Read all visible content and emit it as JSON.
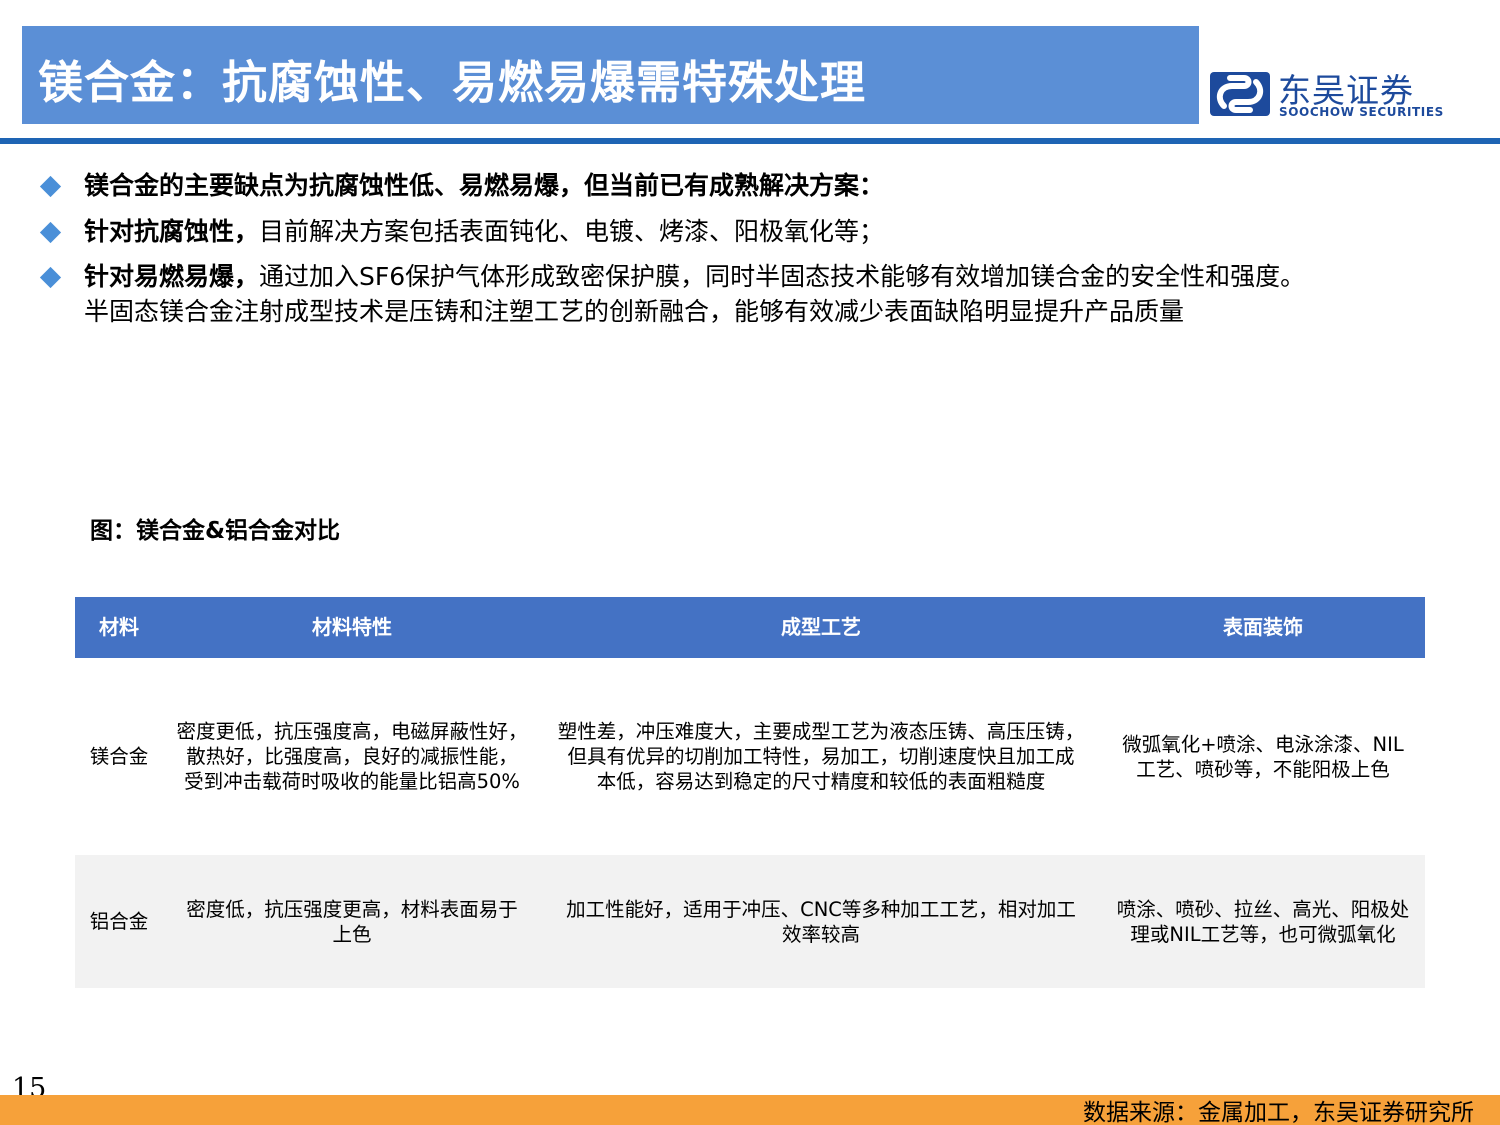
{
  "header": {
    "title": "镁合金：抗腐蚀性、易燃易爆需特殊处理",
    "logo_cn": "东吴证券",
    "logo_en": "SOOCHOW SECURITIES",
    "brand_color": "#1d4a9c",
    "title_bar_color": "#5b8fd6"
  },
  "bullets": [
    {
      "bold": "镁合金的主要缺点为抗腐蚀性低、易燃易爆，但当前已有成熟解决方案：",
      "text": ""
    },
    {
      "bold": "针对抗腐蚀性，",
      "text": "目前解决方案包括表面钝化、电镀、烤漆、阳极氧化等；"
    },
    {
      "bold": "针对易燃易爆，",
      "text": "通过加入SF6保护气体形成致密保护膜，同时半固态技术能够有效增加镁合金的安全性和强度。",
      "continuation": "半固态镁合金注射成型技术是压铸和注塑工艺的创新融合，能够有效减少表面缺陷明显提升产品质量"
    }
  ],
  "figure": {
    "caption": "图：镁合金&铝合金对比"
  },
  "table": {
    "header_color": "#4472c4",
    "headers": [
      "材料",
      "材料特性",
      "成型工艺",
      "表面装饰"
    ],
    "rows": [
      {
        "material": "镁合金",
        "properties": [
          "密度更低，抗压强度高，电磁屏蔽性好，",
          "散热好，比强度高，良好的减振性能，",
          "受到冲击载荷时吸收的能量比铝高50%"
        ],
        "process": [
          "塑性差，冲压难度大，主要成型工艺为液态压铸、高压压铸，",
          "但具有优异的切削加工特性，易加工，切削速度快且加工成",
          "本低，容易达到稳定的尺寸精度和较低的表面粗糙度"
        ],
        "finish": [
          "微弧氧化+喷涂、电泳涂漆、NIL",
          "工艺、喷砂等，不能阳极上色"
        ]
      },
      {
        "material": "铝合金",
        "properties": [
          "密度低，抗压强度更高，材料表面易于",
          "上色"
        ],
        "process": [
          "加工性能好，适用于冲压、CNC等多种加工工艺，相对加工",
          "效率较高"
        ],
        "finish": [
          "喷涂、喷砂、拉丝、高光、阳极处",
          "理或NIL工艺等，也可微弧氧化"
        ]
      }
    ]
  },
  "footer": {
    "page_number": "15",
    "source": "数据来源：金属加工，东吴证券研究所",
    "bar_color": "#f6a13a"
  }
}
